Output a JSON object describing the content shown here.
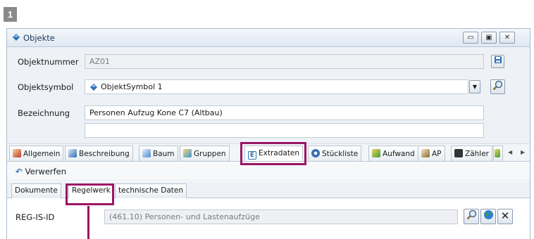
{
  "badge": "1",
  "window": {
    "title": "Objekte",
    "buttons": {
      "minimize": "▭",
      "maximize": "▣",
      "close": "✕"
    }
  },
  "form": {
    "objektnummer_label": "Objektnummer",
    "objektnummer_value": "AZ01",
    "objektsymbol_label": "Objektsymbol",
    "objektsymbol_value": "ObjektSymbol 1",
    "bezeichnung_label": "Bezeichnung",
    "bezeichnung_value": "Personen Aufzug Kone C7 (Altbau)",
    "bezeichnung2_value": ""
  },
  "tabs": [
    {
      "label": "Allgemein",
      "icon": "edit-icon",
      "color": "#c0392b"
    },
    {
      "label": "Beschreibung",
      "icon": "description-icon",
      "color": "#2e6fb5"
    },
    {
      "label": "Baum",
      "icon": "tree-icon",
      "color": "#4a8bd0"
    },
    {
      "label": "Gruppen",
      "icon": "groups-icon",
      "color": "#e0a020"
    },
    {
      "label": "Extradaten",
      "icon": "extradaten-e-icon",
      "color": "#2e6fb5"
    },
    {
      "label": "Stückliste",
      "icon": "gear-icon",
      "color": "#3a6fb0"
    },
    {
      "label": "Aufwand",
      "icon": "effort-icon",
      "color": "#3aa03a"
    },
    {
      "label": "AP",
      "icon": "contact-icon",
      "color": "#8a6a30"
    },
    {
      "label": "Zähler",
      "icon": "counter-icon",
      "color": "#333333"
    }
  ],
  "toolbar": {
    "verwerfen_label": "Verwerfen",
    "verwerfen_icon": "undo-icon"
  },
  "subtabs": [
    "Dokumente",
    "Regelwerk",
    "technische Daten"
  ],
  "regelwerk": {
    "label": "REG-IS-ID",
    "value": "(461.10) Personen- und Lastenaufzüge"
  },
  "colors": {
    "highlight": "#9c1465",
    "accent": "#2e6fb5"
  }
}
